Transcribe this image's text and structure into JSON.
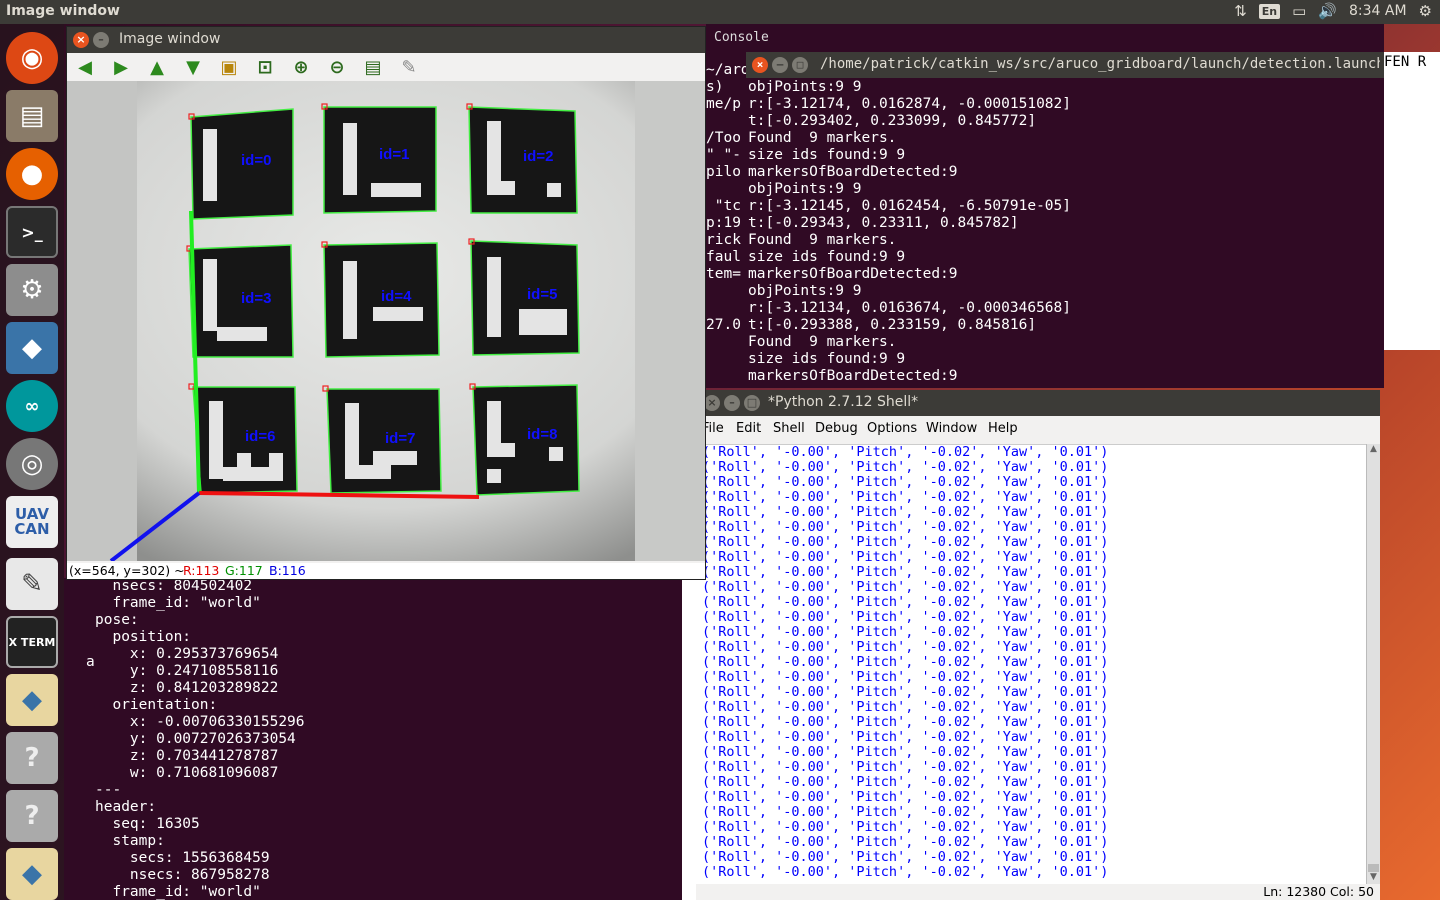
{
  "top_panel": {
    "title": "Image window",
    "keyboard": "En",
    "time": "8:34 AM"
  },
  "launcher": {
    "items": [
      {
        "name": "ubuntu-dash-icon",
        "color": "#dd4814"
      },
      {
        "name": "files-icon",
        "color": "#7a6b5a"
      },
      {
        "name": "firefox-icon",
        "color": "#e66000"
      },
      {
        "name": "terminal-icon",
        "color": "#2b2b2b"
      },
      {
        "name": "system-settings-icon",
        "color": "#9b9b9b"
      },
      {
        "name": "python-icon",
        "color": "#3a74a8"
      },
      {
        "name": "arduino-icon",
        "color": "#00979c"
      },
      {
        "name": "webcam-icon",
        "color": "#888888"
      },
      {
        "name": "uavcan-icon",
        "color": "#2d5ea8"
      },
      {
        "name": "text-editor-icon",
        "color": "#e8e8e8"
      },
      {
        "name": "xterm-icon",
        "color": "#222222"
      },
      {
        "name": "python-file-icon",
        "color": "#e8d6a0"
      },
      {
        "name": "unknown-app-icon-1",
        "color": "#aaaaaa"
      },
      {
        "name": "unknown-app-icon-2",
        "color": "#aaaaaa"
      },
      {
        "name": "python-idle-icon",
        "color": "#e8d6a0"
      }
    ],
    "labels": [
      "UAV CAN",
      "X TERM",
      "?",
      "?"
    ]
  },
  "image_window": {
    "title": "Image window",
    "status_coords": "(x=564, y=302) ~",
    "status_r": "R:113",
    "status_g": "G:117",
    "status_b": "B:116",
    "marker_labels": [
      "id=0",
      "id=1",
      "id=2",
      "id=3",
      "id=4",
      "id=5",
      "id=6",
      "id=7",
      "id=8"
    ]
  },
  "console": {
    "label": "Console",
    "path_title": "/home/patrick/catkin_ws/src/aruco_gridboard/launch/detection.launch htt",
    "side_lines": [
      "~/ard",
      "s)",
      "me/p",
      "",
      "/Too",
      "\" \"-",
      "pilo",
      "",
      " \"tc",
      "p:19",
      "rick",
      "faul",
      "tem=",
      "",
      "",
      "27.0"
    ],
    "lines": [
      "objPoints:9 9",
      "r:[-3.12174, 0.0162874, -0.000151082]",
      "t:[-0.293402, 0.233099, 0.845772]",
      "Found  9 markers.",
      "size ids found:9 9",
      "markersOfBoardDetected:9",
      "objPoints:9 9",
      "r:[-3.12145, 0.0162454, -6.50791e-05]",
      "t:[-0.29343, 0.23311, 0.845782]",
      "Found  9 markers.",
      "size ids found:9 9",
      "markersOfBoardDetected:9",
      "objPoints:9 9",
      "r:[-3.12134, 0.0163674, -0.000346568]",
      "t:[-0.293388, 0.233159, 0.845816]",
      "Found  9 markers.",
      "size ids found:9 9",
      "markersOfBoardDetected:9"
    ],
    "right_snippet": "FEN  R"
  },
  "bottom_terminal": {
    "side_char": "a",
    "lines": [
      "  nsecs: 804502402",
      "  frame_id: \"world\"",
      "pose:",
      "  position:",
      "    x: 0.295373769654",
      "    y: 0.247108558116",
      "    z: 0.841203289822",
      "  orientation:",
      "    x: -0.00706330155296",
      "    y: 0.00727026373054",
      "    z: 0.703441278787",
      "    w: 0.710681096087",
      "---",
      "header:",
      "  seq: 16305",
      "  stamp:",
      "    secs: 1556368459",
      "    nsecs: 867958278",
      "  frame_id: \"world\""
    ]
  },
  "python_shell": {
    "title": "*Python 2.7.12 Shell*",
    "menu": [
      "File",
      "Edit",
      "Shell",
      "Debug",
      "Options",
      "Window",
      "Help"
    ],
    "row_text": "('Roll', '-0.00', 'Pitch', '-0.02', 'Yaw', '0.01')",
    "row_count": 29,
    "status": "Ln: 12380  Col: 50"
  }
}
